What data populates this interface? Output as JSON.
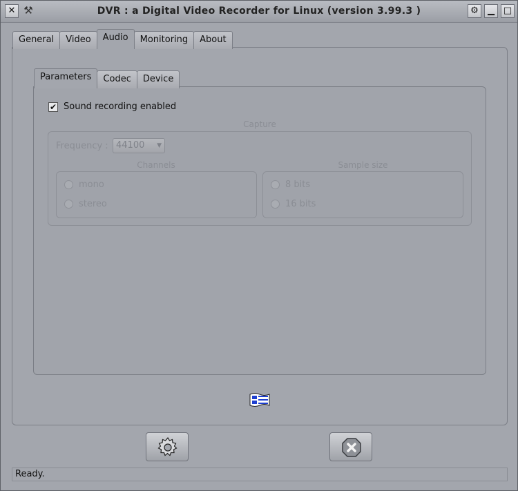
{
  "window": {
    "title": "DVR : a Digital Video Recorder for Linux (version 3.99.3 )",
    "close_glyph": "✕",
    "tools_glyph": "⚒",
    "ctrl1_glyph": "⚙",
    "ctrl2_glyph": "▁",
    "ctrl3_glyph": "□"
  },
  "outer_tabs": [
    "General",
    "Video",
    "Audio",
    "Monitoring",
    "About"
  ],
  "outer_active": "Audio",
  "inner_tabs": [
    "Parameters",
    "Codec",
    "Device"
  ],
  "inner_active": "Parameters",
  "sound": {
    "label": "Sound recording enabled",
    "checked": true,
    "check_glyph": "✔"
  },
  "capture": {
    "title": "Capture",
    "frequency_label": "Frequency :",
    "frequency_value": "44100",
    "dropdown_glyph": "▼",
    "channels_title": "Channels",
    "channels": [
      "mono",
      "stereo"
    ],
    "sample_title": "Sample size",
    "samples": [
      "8 bits",
      "16 bits"
    ]
  },
  "icons": {
    "audio": "audio-flag-icon",
    "ok": "gear-icon",
    "cancel": "cancel-icon"
  },
  "status": {
    "text": "Ready."
  }
}
